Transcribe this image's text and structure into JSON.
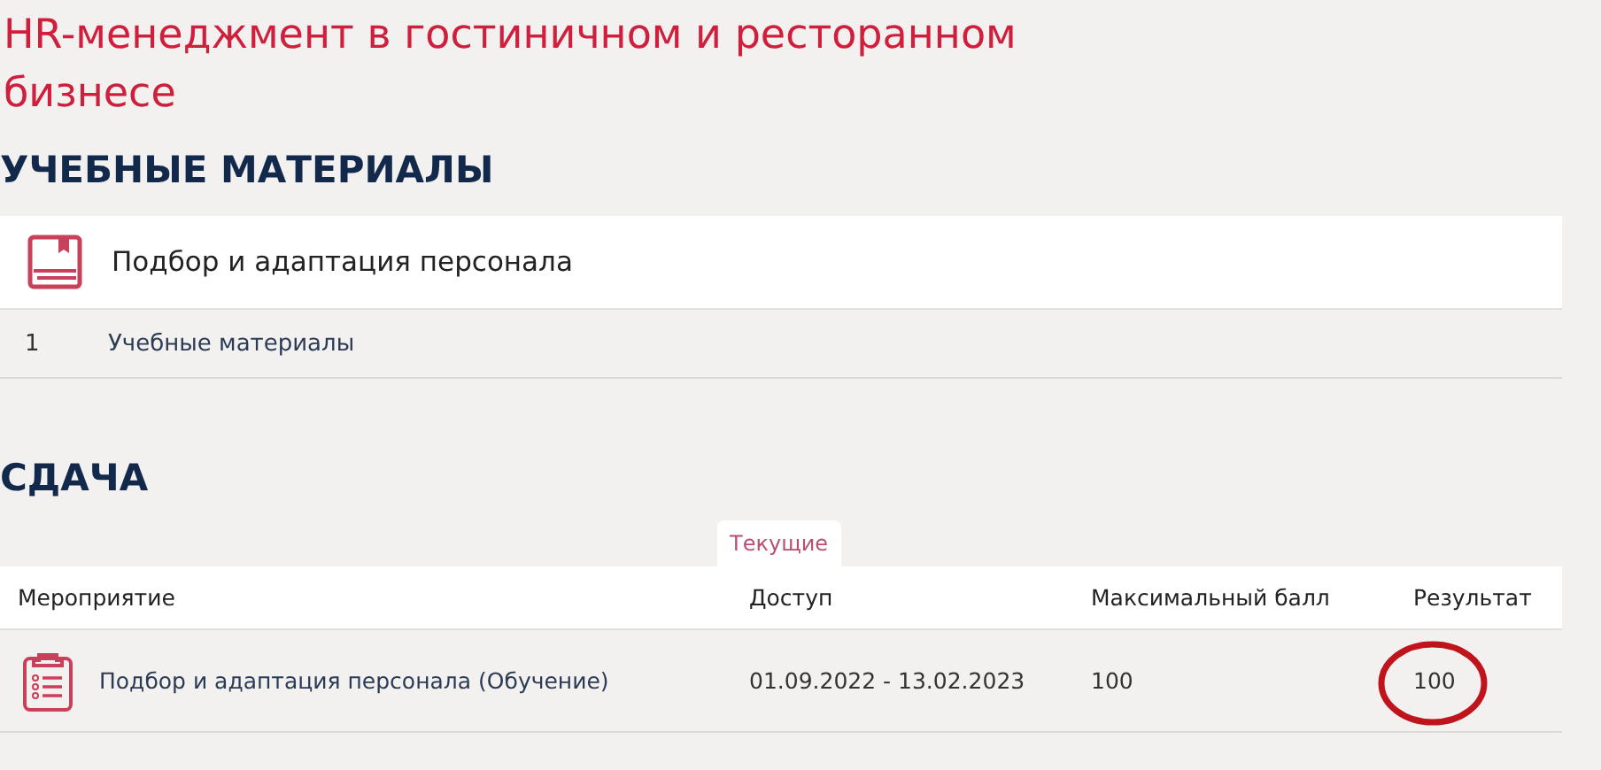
{
  "title": "HR-менеджмент в гостиничном и ресторанном бизнесе",
  "materials": {
    "heading": "УЧЕБНЫЕ МАТЕРИАЛЫ",
    "module": "Подбор и адаптация персонала",
    "items": [
      {
        "number": "1",
        "label": "Учебные материалы"
      }
    ]
  },
  "submission": {
    "heading": "СДАЧА",
    "tabs": [
      {
        "label": "Текущие",
        "selected": true
      }
    ],
    "columns": [
      "Мероприятие",
      "Доступ",
      "Максимальный балл",
      "Результат"
    ],
    "rows": [
      {
        "event": "Подбор и адаптация персонала (Обучение)",
        "access": "01.09.2022 - 13.02.2023",
        "max_score": "100",
        "result": "100",
        "circled": true
      }
    ]
  }
}
